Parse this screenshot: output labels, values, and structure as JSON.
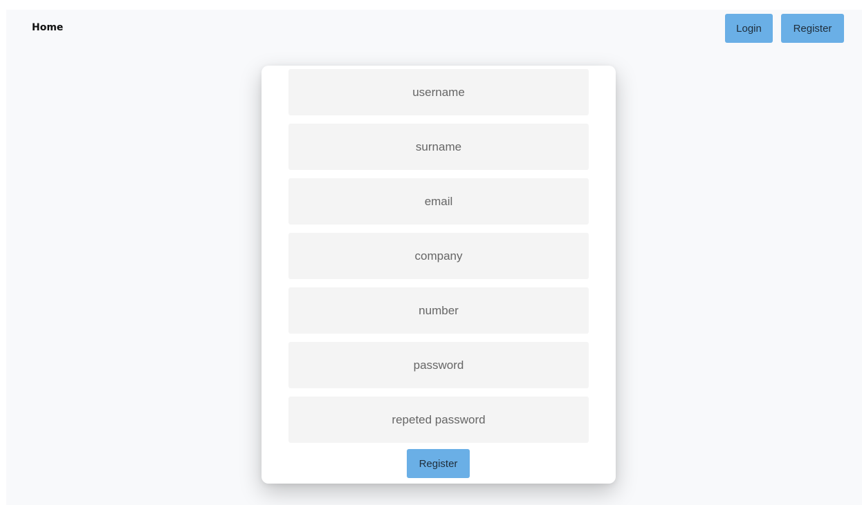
{
  "nav": {
    "home_label": "Home",
    "login_label": "Login",
    "register_label": "Register"
  },
  "form": {
    "fields": [
      {
        "placeholder": "username",
        "value": ""
      },
      {
        "placeholder": "surname",
        "value": ""
      },
      {
        "placeholder": "email",
        "value": ""
      },
      {
        "placeholder": "company",
        "value": ""
      },
      {
        "placeholder": "number",
        "value": ""
      },
      {
        "placeholder": "password",
        "value": ""
      },
      {
        "placeholder": "repeted password",
        "value": ""
      }
    ],
    "submit_label": "Register"
  },
  "colors": {
    "accent": "#6aafe6",
    "page_background": "#f8f9fb",
    "field_background": "#f4f4f4"
  }
}
